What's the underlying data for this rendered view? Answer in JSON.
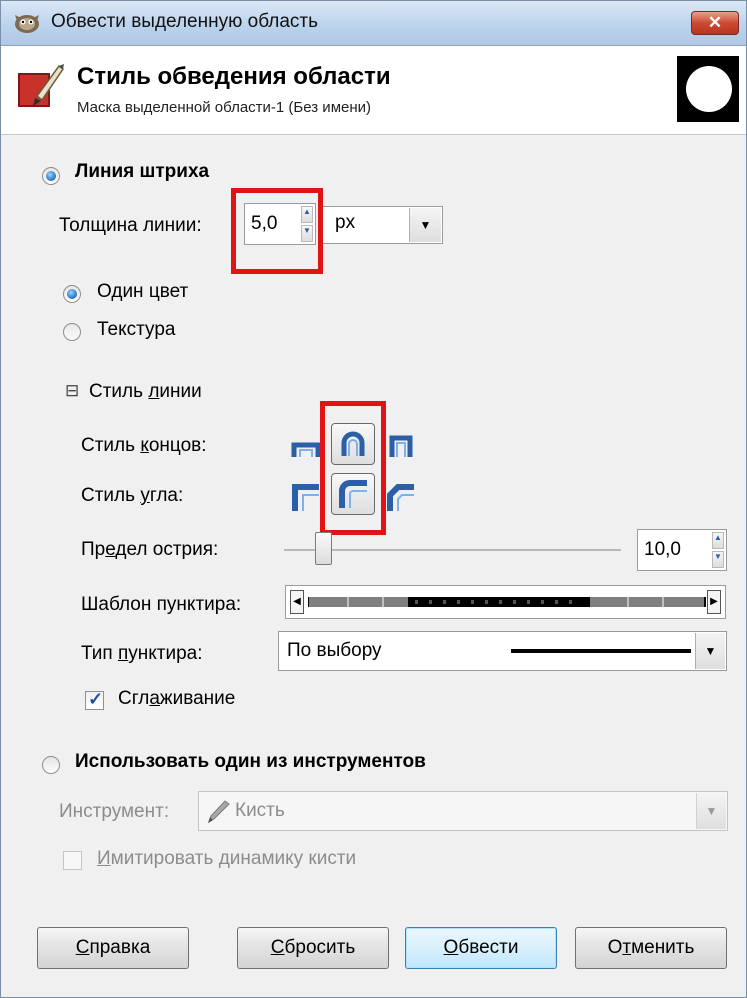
{
  "window": {
    "title": "Обвести выделенную область",
    "close_label": "✕"
  },
  "header": {
    "title": "Стиль обведения области",
    "subtitle": "Маска выделенной области-1 (Без имени)"
  },
  "stroke_line": {
    "radio_label": "Линия штриха",
    "selected": true,
    "width_label": "Толщина линии:",
    "width_value": "5,0",
    "unit_value": "px",
    "solid_color_label": "Один цвет",
    "solid_color_selected": true,
    "pattern_label": "Текстура",
    "pattern_selected": false
  },
  "line_style": {
    "expander_symbol": "⊟",
    "title_pre": "Стиль ",
    "title_ul": "л",
    "title_post": "инии",
    "cap_pre": "Стиль ",
    "cap_ul": "к",
    "cap_post": "онцов:",
    "join_pre": "Стиль ",
    "join_ul": "у",
    "join_post": "гла:",
    "miter_pre": "Пр",
    "miter_ul": "е",
    "miter_post": "дел острия:",
    "miter_value": "10,0",
    "miter_fraction": 0.1,
    "dash_pattern_label": "Шаблон пунктира:",
    "dash_preset_pre": "Тип ",
    "dash_preset_ul": "п",
    "dash_preset_post": "унктира:",
    "dash_preset_value": "По выбору",
    "antialias_pre": "Сгл",
    "antialias_ul": "а",
    "antialias_post": "живание",
    "antialias_checked": true,
    "cap_styles": [
      "butt-cap-icon",
      "round-cap-icon",
      "square-cap-icon"
    ],
    "cap_selected": "round-cap-icon",
    "join_styles": [
      "miter-join-icon",
      "round-join-icon",
      "bevel-join-icon"
    ],
    "join_selected": "round-join-icon"
  },
  "paint_tool": {
    "radio_label": "Использовать один из инструментов",
    "selected": false,
    "tool_label": "Инструмент:",
    "tool_value": "Кисть",
    "emulate_ul": "И",
    "emulate_post": "митировать динамику кисти",
    "emulate_checked": false
  },
  "buttons": {
    "help_ul": "С",
    "help_post": "правка",
    "reset_ul": "С",
    "reset_post": "бросить",
    "stroke_ul": "О",
    "stroke_post": "бвести",
    "cancel_pre": "О",
    "cancel_ul": "т",
    "cancel_post": "менить"
  },
  "colors": {
    "highlight_box": "#e01414",
    "accent_blue": "#2b5fa6"
  }
}
